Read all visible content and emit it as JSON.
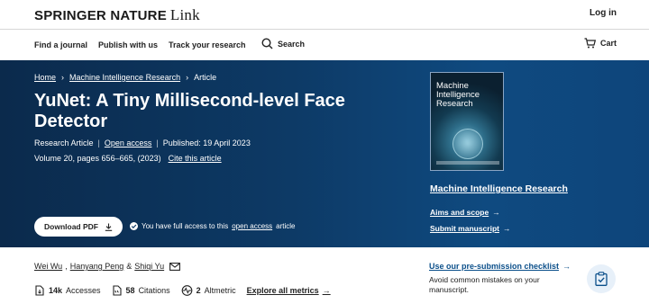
{
  "header": {
    "brand": "SPRINGER NATURE",
    "brand_suffix": "Link",
    "login": "Log in"
  },
  "nav": {
    "find_journal": "Find a journal",
    "publish": "Publish with us",
    "track": "Track your research",
    "search": "Search",
    "cart": "Cart"
  },
  "breadcrumb": [
    "Home",
    "Machine Intelligence Research",
    "Article"
  ],
  "article": {
    "title": "YuNet: A Tiny Millisecond-level Face Detector",
    "type": "Research Article",
    "access": "Open access",
    "published": "Published: 19 April 2023",
    "volume": "Volume 20, pages 656–665, (2023)",
    "cite": "Cite this article",
    "download": "Download PDF",
    "access_note_pre": "You have full access to this",
    "access_note_link": "open access",
    "access_note_post": "article"
  },
  "journal": {
    "cover_title_1": "Machine",
    "cover_title_2": "Intelligence",
    "cover_title_3": "Research",
    "name": "Machine Intelligence Research",
    "aims": "Aims and scope",
    "submit": "Submit manuscript"
  },
  "authors": {
    "a1": "Wei Wu",
    "a2": "Hanyang Peng",
    "amp": "&",
    "a3": "Shiqi Yu"
  },
  "metrics": {
    "accesses_value": "14k",
    "accesses_label": "Accesses",
    "citations_value": "58",
    "citations_label": "Citations",
    "altmetric_value": "2",
    "altmetric_label": "Altmetric",
    "explore": "Explore all metrics"
  },
  "sidebar": {
    "checklist": "Use our pre-submission checklist",
    "avoid": "Avoid common mistakes on your manuscript."
  },
  "colors": {
    "hero_dark": "#0b2a4c",
    "hero_light": "#0f4a80",
    "link_blue": "#0b4f8a"
  }
}
